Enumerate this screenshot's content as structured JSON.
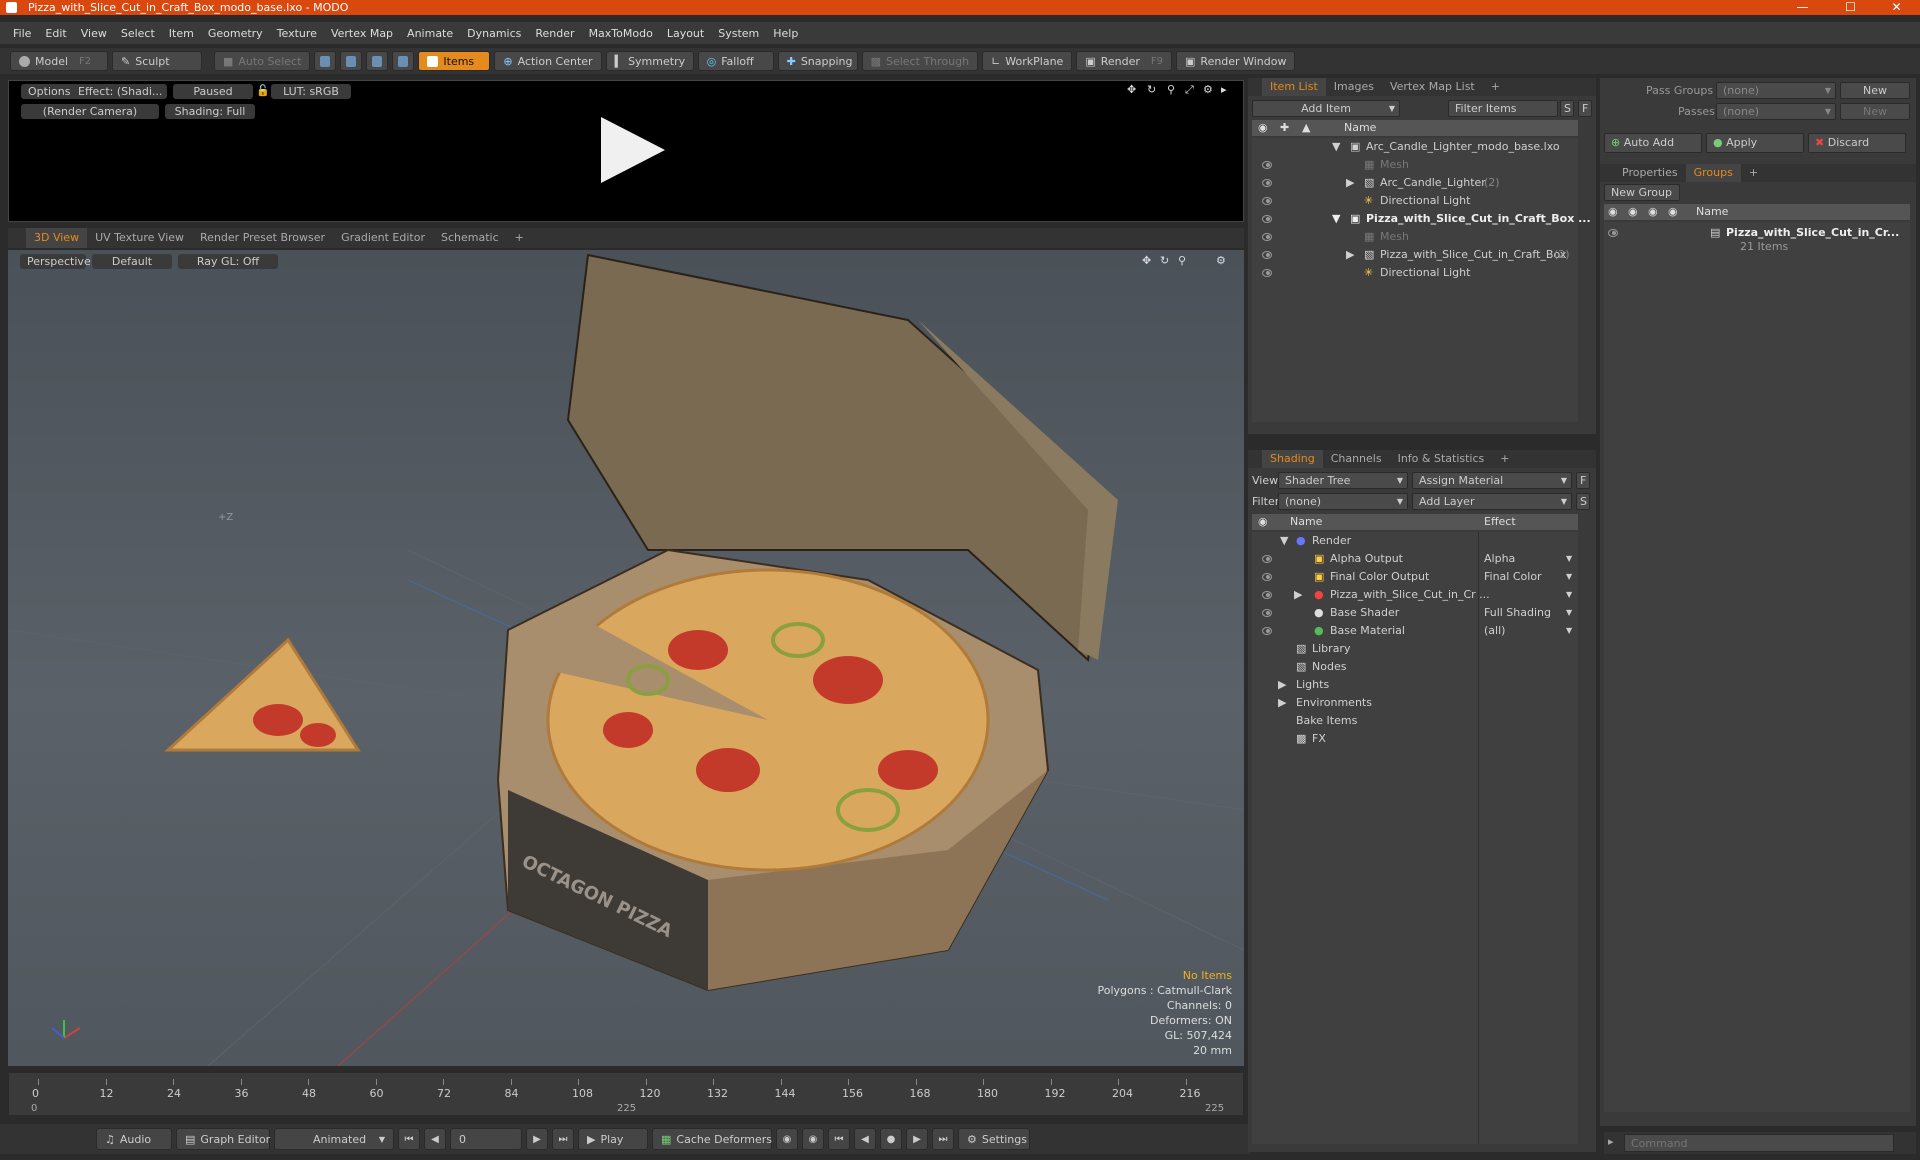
{
  "window": {
    "title": "Pizza_with_Slice_Cut_in_Craft_Box_modo_base.lxo - MODO"
  },
  "menu": [
    "File",
    "Edit",
    "View",
    "Select",
    "Item",
    "Geometry",
    "Texture",
    "Vertex Map",
    "Animate",
    "Dynamics",
    "Render",
    "MaxToModo",
    "Layout",
    "System",
    "Help"
  ],
  "toolbar": {
    "model": "Model",
    "model_hotkey": "F2",
    "sculpt": "Sculpt",
    "auto_select": "Auto Select",
    "items": "Items",
    "action_center": "Action Center",
    "symmetry": "Symmetry",
    "falloff": "Falloff",
    "snapping": "Snapping",
    "select_through": "Select Through",
    "workplane": "WorkPlane",
    "render": "Render",
    "render_hotkey": "F9",
    "render_window": "Render Window"
  },
  "render_preview": {
    "options": "Options",
    "effect": "Effect: (Shadi...",
    "paused": "Paused",
    "lut": "LUT: sRGB",
    "camera": "(Render Camera)",
    "shading": "Shading: Full"
  },
  "viewport_tabs": [
    "3D View",
    "UV Texture View",
    "Render Preset Browser",
    "Gradient Editor",
    "Schematic",
    "+"
  ],
  "viewport": {
    "perspective": "Perspective",
    "default": "Default",
    "raygl": "Ray GL: Off",
    "axis_label": "+Z",
    "box_label": "OCTAGON PIZZA",
    "info": {
      "no_items": "No Items",
      "polygons": "Polygons : Catmull-Clark",
      "channels": "Channels: 0",
      "deformers": "Deformers: ON",
      "gl": "GL: 507,424",
      "scale": "20 mm"
    }
  },
  "timeline": {
    "ticks": [
      "0",
      "12",
      "24",
      "36",
      "48",
      "60",
      "72",
      "84",
      "108",
      "120",
      "132",
      "144",
      "156",
      "168",
      "180",
      "192",
      "204",
      "216"
    ],
    "lower": {
      "start": "0",
      "mid": "225",
      "end": "225"
    }
  },
  "bottombar": {
    "audio": "Audio",
    "graph_editor": "Graph Editor",
    "animated": "Animated",
    "frame": "0",
    "play": "Play",
    "cache_deformers": "Cache Deformers",
    "settings": "Settings"
  },
  "item_list": {
    "tabs": [
      "Item List",
      "Images",
      "Vertex Map List",
      "+"
    ],
    "add_item": "Add Item",
    "filter": "Filter Items",
    "s": "S",
    "f": "F",
    "col_name": "Name",
    "items": [
      {
        "label": "Arc_Candle_Lighter_modo_base.lxo",
        "count": ""
      },
      {
        "label": "Mesh",
        "count": ""
      },
      {
        "label": "Arc_Candle_Lighter",
        "count": "(2)"
      },
      {
        "label": "Directional Light",
        "count": ""
      },
      {
        "label": "Pizza_with_Slice_Cut_in_Craft_Box ...",
        "count": ""
      },
      {
        "label": "Mesh",
        "count": ""
      },
      {
        "label": "Pizza_with_Slice_Cut_in_Craft_Box",
        "count": "(2)"
      },
      {
        "label": "Directional Light",
        "count": ""
      }
    ]
  },
  "groups_panel": {
    "pass_groups": "Pass Groups",
    "passes": "Passes",
    "none": "(none)",
    "new": "New",
    "auto_add": "Auto Add",
    "apply": "Apply",
    "discard": "Discard",
    "tabs": [
      "Properties",
      "Groups",
      "+"
    ],
    "new_group": "New Group",
    "col_name": "Name",
    "group_name": "Pizza_with_Slice_Cut_in_Cr...",
    "group_count": "21 Items"
  },
  "shading": {
    "tabs": [
      "Shading",
      "Channels",
      "Info & Statistics",
      "+"
    ],
    "view_label": "View",
    "view_value": "Shader Tree",
    "assign_material": "Assign Material",
    "filter_label": "Filter",
    "filter_value": "(none)",
    "add_layer": "Add Layer",
    "f": "F",
    "s": "S",
    "col_name": "Name",
    "col_effect": "Effect",
    "rows": [
      {
        "label": "Render",
        "effect": ""
      },
      {
        "label": "Alpha Output",
        "effect": "Alpha"
      },
      {
        "label": "Final Color Output",
        "effect": "Final Color"
      },
      {
        "label": "Pizza_with_Slice_Cut_in_Cr ...",
        "effect": ""
      },
      {
        "label": "Base Shader",
        "effect": "Full Shading"
      },
      {
        "label": "Base Material",
        "effect": "(all)"
      },
      {
        "label": "Library",
        "effect": ""
      },
      {
        "label": "Nodes",
        "effect": ""
      },
      {
        "label": "Lights",
        "effect": ""
      },
      {
        "label": "Environments",
        "effect": ""
      },
      {
        "label": "Bake Items",
        "effect": ""
      },
      {
        "label": "FX",
        "effect": ""
      }
    ]
  },
  "command": {
    "placeholder": "Command"
  },
  "colors": {
    "accent": "#e58a1c",
    "titlebar": "#d9480f",
    "viewport": "#555c63"
  }
}
